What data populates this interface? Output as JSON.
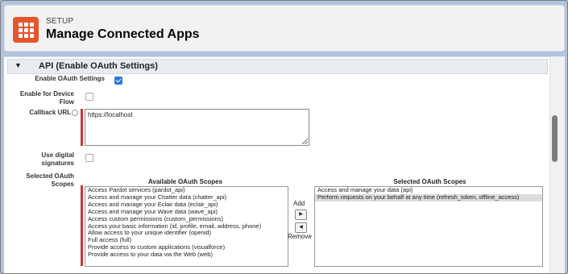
{
  "header": {
    "eyebrow": "SETUP",
    "title": "Manage Connected Apps"
  },
  "section": {
    "title": "API (Enable OAuth Settings)"
  },
  "fields": {
    "enable_oauth": {
      "label": "Enable OAuth Settings",
      "checked": true
    },
    "enable_device_flow": {
      "label_line1": "Enable for Device",
      "label_line2": "Flow",
      "checked": false
    },
    "callback_url": {
      "label": "Callback URL",
      "value": "https://localhost"
    },
    "digital_signatures": {
      "label_line1": "Use digital",
      "label_line2": "signatures",
      "checked": false
    },
    "selected_scopes": {
      "label_line1": "Selected OAuth",
      "label_line2": "Scopes"
    }
  },
  "available_scopes": {
    "title": "Available OAuth Scopes",
    "items": [
      "Access Pardot services (pardot_api)",
      "Access and manage your Chatter data (chatter_api)",
      "Access and manage your Eclair data (eclair_api)",
      "Access and manage your Wave data (wave_api)",
      "Access custom permissions (custom_permissions)",
      "Access your basic information (id, profile, email, address, phone)",
      "Allow access to your unique identifier (openid)",
      "Full access (full)",
      "Provide access to custom applications (visualforce)",
      "Provide access to your data via the Web (web)"
    ]
  },
  "selected_scopes": {
    "title": "Selected OAuth Scopes",
    "items": [
      "Access and manage your data (api)",
      "Perform requests on your behalf at any time (refresh_token, offline_access)"
    ],
    "highlighted_index": 1
  },
  "mover": {
    "add_label": "Add",
    "remove_label": "Remove",
    "add_icon": "arrow-right-icon",
    "remove_icon": "arrow-left-icon"
  },
  "colors": {
    "accent": "#e4572e",
    "required": "#c23934",
    "checkbox": "#2a7ae2"
  }
}
